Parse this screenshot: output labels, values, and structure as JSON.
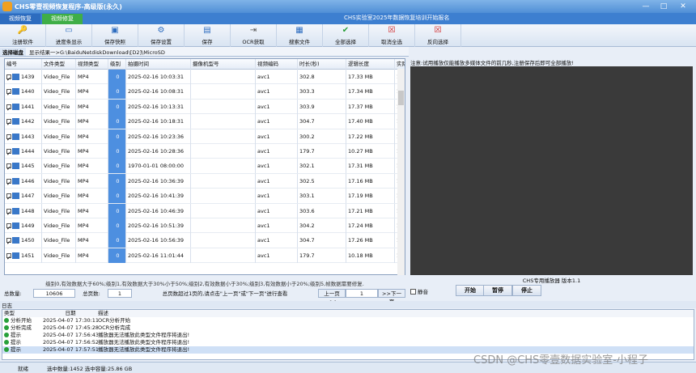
{
  "app": {
    "title": "CHS零壹视频恢复程序-高级版(永久)",
    "notice": "CHS实验室2025年数据恢复培训开始报名"
  },
  "tabs": [
    {
      "label": "视频恢复"
    },
    {
      "label": "视频修复"
    }
  ],
  "toolbar": [
    {
      "label": "注册软件",
      "icon": "key-icon"
    },
    {
      "label": "进度条显示",
      "icon": "progress-icon"
    },
    {
      "label": "保存快照",
      "icon": "snapshot-icon"
    },
    {
      "label": "保存设置",
      "icon": "settings-icon"
    },
    {
      "label": "保存",
      "icon": "save-icon"
    },
    {
      "label": "OCR获取",
      "icon": "ocr-icon"
    },
    {
      "label": "搜索文件",
      "icon": "search-icon"
    },
    {
      "label": "全部选择",
      "icon": "check-icon"
    },
    {
      "label": "取消全选",
      "icon": "cancel-icon"
    },
    {
      "label": "反向选择",
      "icon": "invert-icon"
    }
  ],
  "pathbar": {
    "select_disk": "选择磁盘",
    "path": "显示结果一>G:\\BaiduNetdiskDownload\\[D2]\\MicroSD"
  },
  "table": {
    "columns": [
      "编号",
      "文件类型",
      "视频类型",
      "级别",
      "拍摄时间",
      "摄像机型号",
      "视频编码",
      "时长(秒)",
      "逻辑长度",
      "实际长"
    ],
    "rows": [
      [
        "1439",
        "Video_File",
        "MP4",
        "0",
        "2025-02-16 10:03:31",
        "",
        "avc1",
        "302.8",
        "17.33 MB",
        "17.37 MB"
      ],
      [
        "1440",
        "Video_File",
        "MP4",
        "0",
        "2025-02-16 10:08:31",
        "",
        "avc1",
        "303.3",
        "17.34 MB",
        "17.38 MB"
      ],
      [
        "1441",
        "Video_File",
        "MP4",
        "0",
        "2025-02-16 10:13:31",
        "",
        "avc1",
        "303.9",
        "17.37 MB",
        "17.40 MB"
      ],
      [
        "1442",
        "Video_File",
        "MP4",
        "0",
        "2025-02-16 10:18:31",
        "",
        "avc1",
        "304.7",
        "17.40 MB",
        "17.44 MB"
      ],
      [
        "1443",
        "Video_File",
        "MP4",
        "0",
        "2025-02-16 10:23:36",
        "",
        "avc1",
        "300.2",
        "17.22 MB",
        "17.26 MB"
      ],
      [
        "1444",
        "Video_File",
        "MP4",
        "0",
        "2025-02-16 10:28:36",
        "",
        "avc1",
        "179.7",
        "10.27 MB",
        "10.30 MB"
      ],
      [
        "1445",
        "Video_File",
        "MP4",
        "0",
        "1970-01-01 08:00:00",
        "",
        "avc1",
        "302.1",
        "17.31 MB",
        "17.35 MB"
      ],
      [
        "1446",
        "Video_File",
        "MP4",
        "0",
        "2025-02-16 10:36:39",
        "",
        "avc1",
        "302.5",
        "17.16 MB",
        "17.20 MB"
      ],
      [
        "1447",
        "Video_File",
        "MP4",
        "0",
        "2025-02-16 10:41:39",
        "",
        "avc1",
        "303.1",
        "17.19 MB",
        "17.22 MB"
      ],
      [
        "1448",
        "Video_File",
        "MP4",
        "0",
        "2025-02-16 10:46:39",
        "",
        "avc1",
        "303.6",
        "17.21 MB",
        "17.25 MB"
      ],
      [
        "1449",
        "Video_File",
        "MP4",
        "0",
        "2025-02-16 10:51:39",
        "",
        "avc1",
        "304.2",
        "17.24 MB",
        "17.28 MB"
      ],
      [
        "1450",
        "Video_File",
        "MP4",
        "0",
        "2025-02-16 10:56:39",
        "",
        "avc1",
        "304.7",
        "17.26 MB",
        "17.30 MB"
      ],
      [
        "1451",
        "Video_File",
        "MP4",
        "0",
        "2025-02-16 11:01:44",
        "",
        "avc1",
        "179.7",
        "10.18 MB",
        "10.18 MB"
      ]
    ]
  },
  "level_note": "级别0,有效数据大于60%;级别1,有效数据大于30%小于50%;级别2,有效数据小于30%;级别3,有效数据小于20%;级别5,帧数据需要修复.",
  "pager": {
    "total_label": "总数量:",
    "total": "10606",
    "pages_label": "总页数:",
    "pages": "1",
    "hint": "总页数超过1页的,请点击\"上一页\"或\"下一页\"进行查看",
    "prev": "上一页<<",
    "page": "1",
    "next": ">>下一页"
  },
  "player": {
    "note": "注意:试用播放仅能播放多媒体文件的前几秒,注册保存后即可全部播放!",
    "label": "CHS专用播放器 版本1.1",
    "mute": "静音",
    "play": "开始",
    "pause": "暂停",
    "stop": "停止"
  },
  "log": {
    "title": "日志",
    "columns": [
      "类型",
      "日期",
      "描述"
    ],
    "rows": [
      [
        "分析开始",
        "2025-04-07 17:30:11",
        "OCR分析开始"
      ],
      [
        "分析完成",
        "2025-04-07 17:45:28",
        "OCR分析完成"
      ],
      [
        "提示",
        "2025-04-07 17:56:43",
        "播放器无法播放此类型文件程序将退出!"
      ],
      [
        "提示",
        "2025-04-07 17:56:52",
        "播放器无法播放此类型文件程序将退出!"
      ],
      [
        "提示",
        "2025-04-07 17:57:51",
        "播放器无法播放此类型文件程序将退出!"
      ]
    ]
  },
  "statusbar": {
    "ready": "就绪",
    "summary": "选中数量:1452 选中容量:25.86 GB"
  },
  "watermark": "CSDN @CHS零壹数据实验室-小程子",
  "colors": {
    "accent": "#3d7fd0",
    "level_cell": "#4d8fe0",
    "player_bg": "#3a3a3a"
  }
}
